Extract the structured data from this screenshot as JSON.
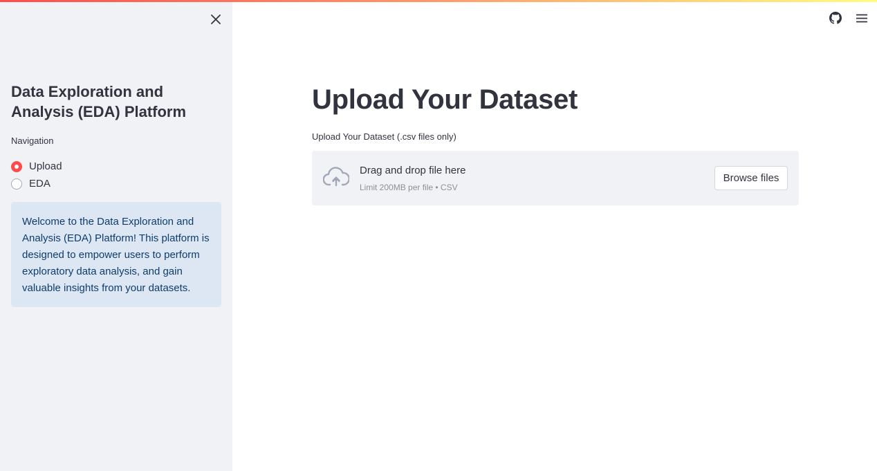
{
  "sidebar": {
    "title": "Data Exploration and Analysis (EDA) Platform",
    "nav_label": "Navigation",
    "nav_options": [
      {
        "label": "Upload",
        "selected": true
      },
      {
        "label": "EDA",
        "selected": false
      }
    ],
    "info_text": "Welcome to the Data Exploration and Analysis (EDA) Platform! This platform is designed to empower users to perform exploratory data analysis, and gain valuable insights from your datasets."
  },
  "header": {
    "icons": [
      "github-icon",
      "hamburger-menu-icon"
    ]
  },
  "main": {
    "title": "Upload Your Dataset",
    "uploader_label": "Upload Your Dataset (.csv files only)",
    "dropzone": {
      "instruction": "Drag and drop file here",
      "limit": "Limit 200MB per file • CSV",
      "button_label": "Browse files",
      "icon": "cloud-upload-icon"
    }
  },
  "colors": {
    "accent": "#ff4b4b",
    "sidebar_bg": "#f0f2f6",
    "info_bg": "#dde7f3",
    "info_text": "#0e3c6c"
  }
}
